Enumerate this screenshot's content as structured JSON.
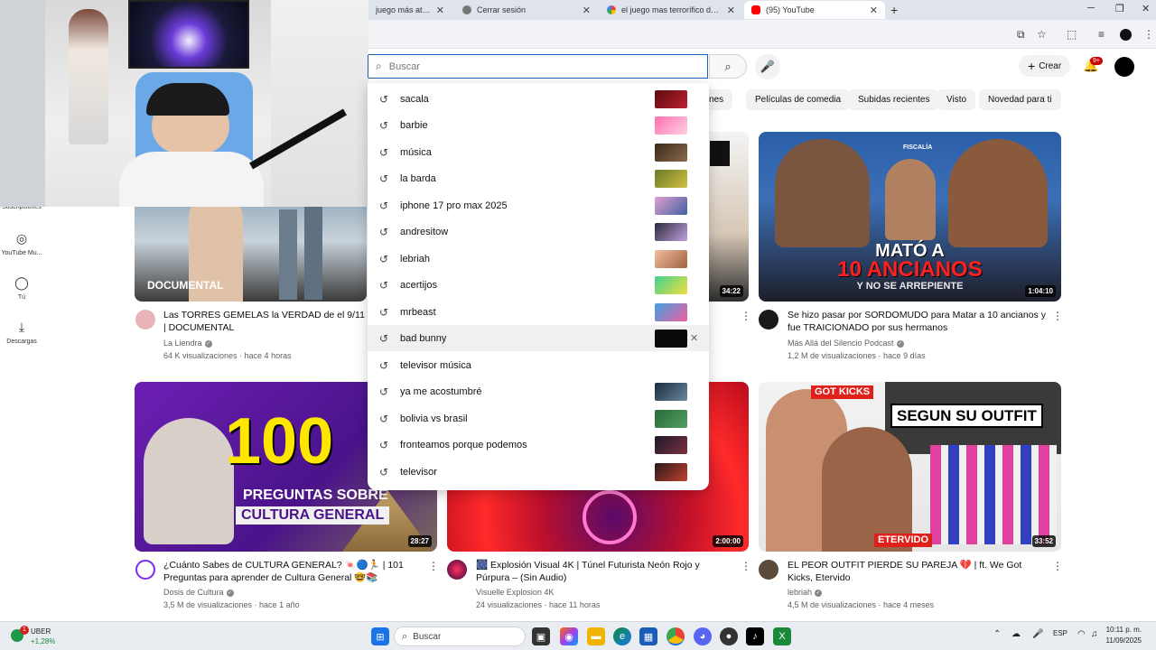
{
  "browser": {
    "tabs": [
      {
        "title": "juego más aterrado"
      },
      {
        "title": "Cerrar sesión"
      },
      {
        "title": "el juego mas terrorífico del mu"
      },
      {
        "title": "(95) YouTube"
      }
    ]
  },
  "header": {
    "search_placeholder": "Buscar",
    "create_label": "Crear",
    "notif_count": "9+"
  },
  "chips": [
    "iciones",
    "Películas de comedia",
    "Subidas recientes",
    "Visto",
    "Novedad para ti"
  ],
  "sidebar": {
    "items": [
      {
        "label": "Suscripciones"
      },
      {
        "label": "YouTube Mu..."
      },
      {
        "label": "Tú"
      },
      {
        "label": "Descargas"
      }
    ]
  },
  "suggestions": [
    {
      "text": "sacala"
    },
    {
      "text": "barbie"
    },
    {
      "text": "música"
    },
    {
      "text": "la barda"
    },
    {
      "text": "iphone 17 pro max 2025"
    },
    {
      "text": "andresitow"
    },
    {
      "text": "lebriah"
    },
    {
      "text": "acertijos"
    },
    {
      "text": "mrbeast"
    },
    {
      "text": "bad bunny"
    },
    {
      "text": "televisor música"
    },
    {
      "text": "ya me acostumbré"
    },
    {
      "text": "bolivia vs brasil"
    },
    {
      "text": "fronteamos porque podemos"
    },
    {
      "text": "televisor"
    }
  ],
  "videos": [
    {
      "title": "Las TORRES GEMELAS la VERDAD de el 9/11 | DOCUMENTAL",
      "channel": "La Liendra",
      "meta": "64 K visualizaciones · hace 4 horas",
      "thumb_text": "DOCUMENTAL"
    },
    {
      "duration": "34:22"
    },
    {
      "title": "Se hizo pasar por SORDOMUDO para Matar a 10 ancianos y fue TRAICIONADO por sus hermanos",
      "channel": "Más Allá del Silencio Podcast",
      "meta": "1,2 M de visualizaciones · hace 9 días",
      "duration": "1:04:10",
      "thumb_line1": "MATÓ A",
      "thumb_line2": "10 ANCIANOS",
      "thumb_line3": "Y NO SE ARREPIENTE",
      "thumb_logo": "FISCALÍA"
    },
    {
      "title": "¿Cuánto Sabes de CULTURA GENERAL? 🍬🔵🏃 | 101 Preguntas para aprender de Cultura General 🤓📚",
      "channel": "Dosis de Cultura",
      "meta": "3,5 M de visualizaciones · hace 1 año",
      "duration": "28:27",
      "thumb_big": "100",
      "thumb_line1": "PREGUNTAS SOBRE",
      "thumb_line2": "CULTURA GENERAL"
    },
    {
      "title": "🎆 Explosión Visual 4K | Túnel Futurista Neón Rojo y Púrpura – (Sin Audio)",
      "channel": "Visuelle Explosion 4K",
      "meta": "24 visualizaciones · hace 11 horas",
      "duration": "2:00:00"
    },
    {
      "title": "EL PEOR OUTFIT PIERDE SU PAREJA 💔 | ft. We Got Kicks, Etervido",
      "channel": "lebriah",
      "meta": "4,5 M de visualizaciones · hace 4 meses",
      "duration": "33:52",
      "thumb_banner": "SEGUN SU OUTFIT",
      "thumb_tag1": "GOT KICKS",
      "thumb_tag2": "ETERVIDO"
    }
  ],
  "taskbar": {
    "weather_label": "UBER",
    "weather_value": "+1,28%",
    "search_label": "Buscar",
    "lang": "ESP",
    "time": "10:11 p. m.",
    "date": "11/09/2025"
  },
  "colors": {
    "accent_blue": "#1c62b9",
    "yt_red": "#ff0000"
  }
}
